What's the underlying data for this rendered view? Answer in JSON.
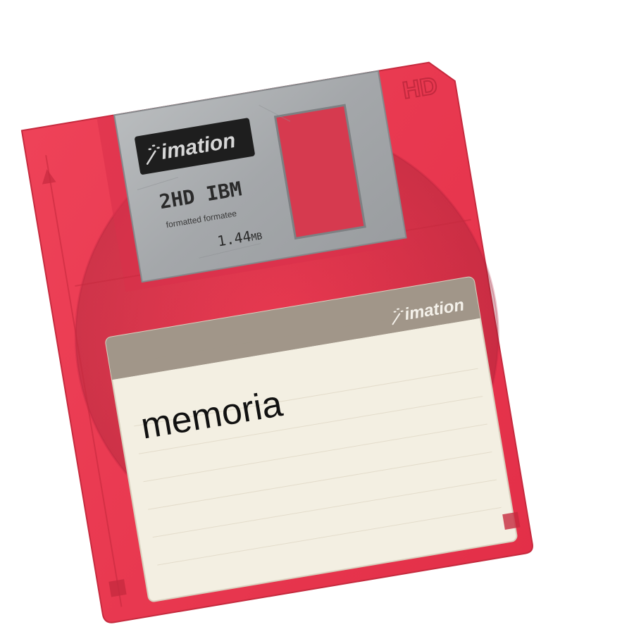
{
  "disk": {
    "body_color": "#e8384f",
    "shutter_color": "#a9acae",
    "label_color": "#f3efe2",
    "label_band_color": "#a19689",
    "density_mark": "HD",
    "shutter": {
      "brand": "imation",
      "format_line": "2HD IBM",
      "format_sub": "formatted formatee",
      "capacity_value": "1.44",
      "capacity_unit": "MB"
    },
    "label": {
      "brand": "imation",
      "handwritten_text": "memoria"
    }
  }
}
